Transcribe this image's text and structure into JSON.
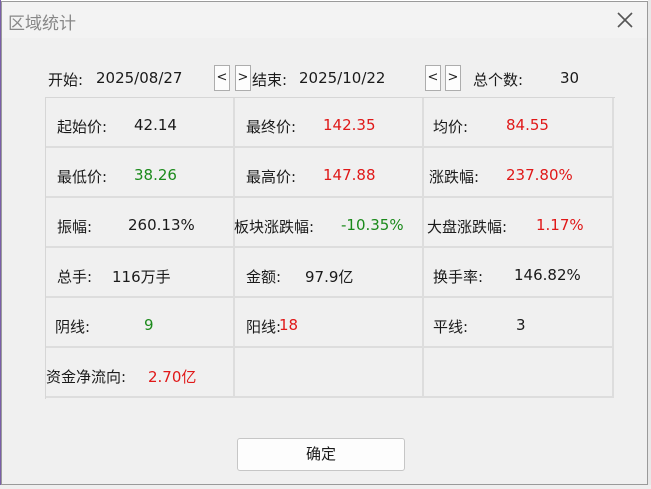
{
  "window": {
    "title": "区域统计"
  },
  "range": {
    "start_label": "开始:",
    "start_value": "2025/08/27",
    "end_label": "结束:",
    "end_value": "2025/10/22",
    "count_label": "总个数:",
    "count_value": "30",
    "prev_glyph": "<",
    "next_glyph": ">"
  },
  "stats": [
    [
      {
        "label": "起始价:",
        "value": "42.14",
        "color": "black"
      },
      {
        "label": "最终价:",
        "value": "142.35",
        "color": "red"
      },
      {
        "label": "均价:",
        "value": "84.55",
        "color": "red"
      }
    ],
    [
      {
        "label": "最低价:",
        "value": "38.26",
        "color": "green"
      },
      {
        "label": "最高价:",
        "value": "147.88",
        "color": "red"
      },
      {
        "label": "涨跌幅:",
        "value": "237.80%",
        "color": "red"
      }
    ],
    [
      {
        "label": "振幅:",
        "value": "260.13%",
        "color": "black"
      },
      {
        "label": "板块涨跌幅:",
        "value": "-10.35%",
        "color": "green"
      },
      {
        "label": "大盘涨跌幅:",
        "value": "1.17%",
        "color": "red"
      }
    ],
    [
      {
        "label": "总手:",
        "value": "116万手",
        "color": "black"
      },
      {
        "label": "金额:",
        "value": "97.9亿",
        "color": "black"
      },
      {
        "label": "换手率:",
        "value": "146.82%",
        "color": "black"
      }
    ],
    [
      {
        "label": "阴线:",
        "value": "9",
        "color": "green"
      },
      {
        "label": "阳线:",
        "value": "18",
        "color": "red"
      },
      {
        "label": "平线:",
        "value": "3",
        "color": "black"
      }
    ],
    [
      {
        "label": "资金净流向:",
        "value": "2.70亿",
        "color": "red"
      },
      {
        "label": "",
        "value": "",
        "color": "black"
      },
      {
        "label": "",
        "value": "",
        "color": "black"
      }
    ]
  ],
  "footer": {
    "ok_label": "确定"
  },
  "icons": {
    "close": "close-icon"
  },
  "colors": {
    "up": "#e01818",
    "down": "#1b8a1b",
    "neutral": "#1a1a1a"
  }
}
